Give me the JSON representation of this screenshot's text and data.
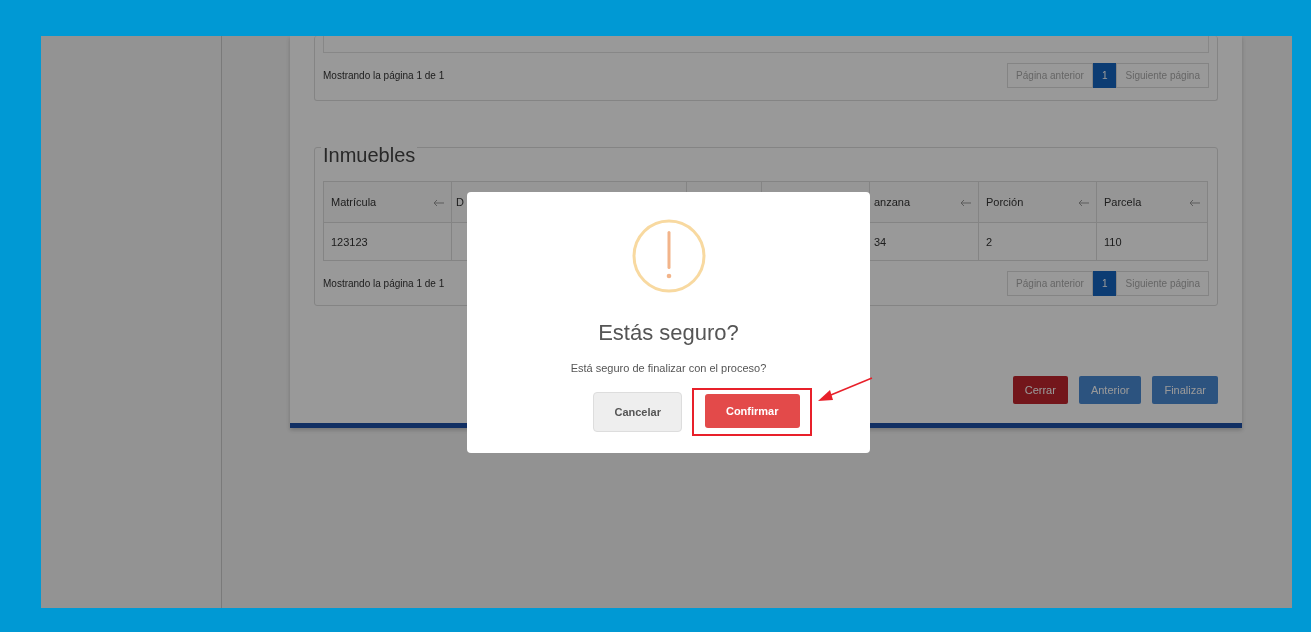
{
  "top_table": {
    "footer": "Mostrando la página 1 de 1",
    "pager": {
      "prev": "Página anterior",
      "page": "1",
      "next": "Siguiente página"
    }
  },
  "inmuebles": {
    "title": "Inmuebles",
    "columns": [
      {
        "label": "Matrícula"
      },
      {
        "label": "D"
      },
      {},
      {},
      {
        "label": "anzana"
      },
      {
        "label": "Porción"
      },
      {
        "label": "Parcela"
      }
    ],
    "rows": [
      [
        "123123",
        null,
        null,
        null,
        "34",
        "2",
        "110"
      ]
    ],
    "footer": "Mostrando la página 1 de 1",
    "pager": {
      "prev": "Página anterior",
      "page": "1",
      "next": "Siguiente página"
    }
  },
  "actions": [
    {
      "label": "Cerrar",
      "kind": "danger"
    },
    {
      "label": "Anterior",
      "kind": "primary"
    },
    {
      "label": "Finalizar",
      "kind": "primary"
    }
  ],
  "dialog": {
    "title": "Estás seguro?",
    "message": "Está seguro de finalizar con el proceso?",
    "cancel": "Cancelar",
    "confirm": "Confirmar",
    "confirm_highlighted": true
  }
}
